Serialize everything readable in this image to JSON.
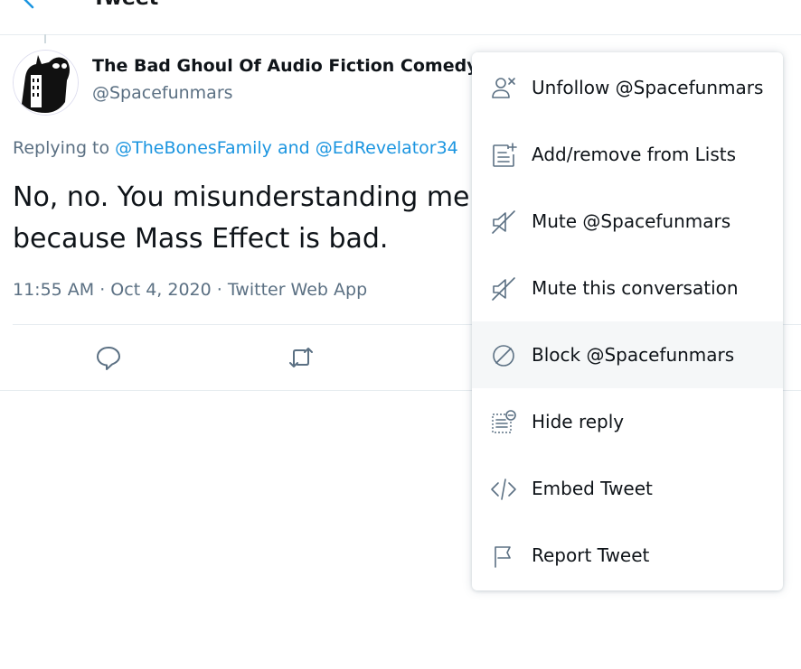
{
  "header": {
    "title": "Tweet"
  },
  "tweet": {
    "display_name": "The Bad Ghoul Of Audio Fiction Comedy",
    "handle": "@Spacefunmars",
    "replying_prefix": "Replying to ",
    "replying_user1": "@TheBonesFamily",
    "replying_and": " and ",
    "replying_user2": "@EdRevelator34",
    "text_line1": "No, no. You misunderstanding me",
    "text_line2": "because Mass Effect is bad.",
    "meta": "11:55 AM · Oct 4, 2020 · Twitter Web App"
  },
  "menu": {
    "items": [
      {
        "label": "Unfollow @Spacefunmars",
        "icon": "unfollow-icon"
      },
      {
        "label": "Add/remove from Lists",
        "icon": "list-add-icon"
      },
      {
        "label": "Mute @Spacefunmars",
        "icon": "mute-icon"
      },
      {
        "label": "Mute this conversation",
        "icon": "mute-icon"
      },
      {
        "label": "Block @Spacefunmars",
        "icon": "block-icon"
      },
      {
        "label": "Hide reply",
        "icon": "hide-reply-icon"
      },
      {
        "label": "Embed Tweet",
        "icon": "embed-icon"
      },
      {
        "label": "Report Tweet",
        "icon": "flag-icon"
      }
    ]
  },
  "colors": {
    "link": "#1b95e0",
    "secondary_text": "#5b7083",
    "menu_hover": "#f5f7f8"
  }
}
